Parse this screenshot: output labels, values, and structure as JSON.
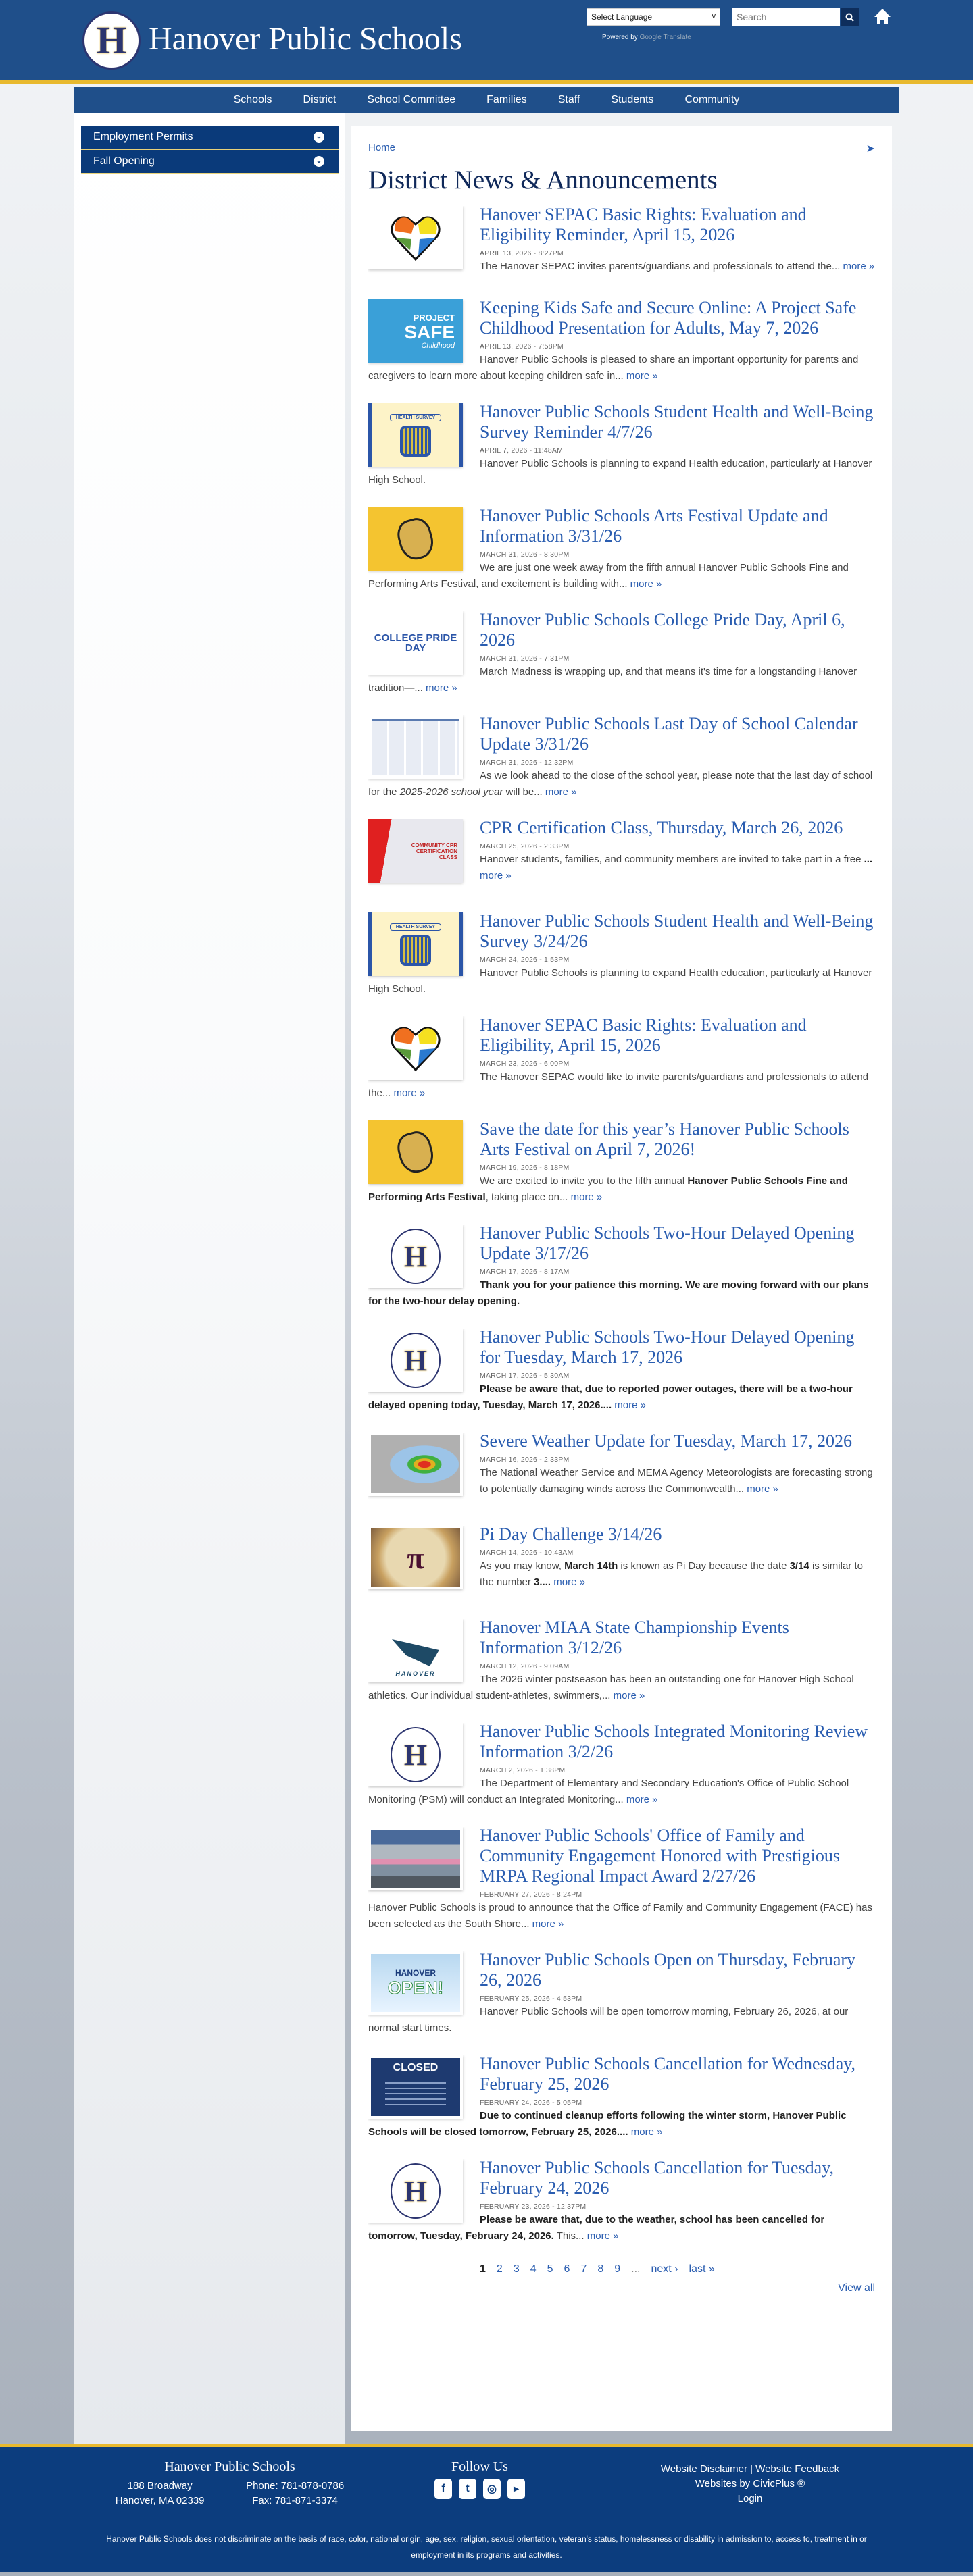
{
  "header": {
    "logo_letter": "H",
    "title": "Hanover Public Schools",
    "language_select": "Select Language",
    "powered_by": "Powered by",
    "translate": "Google Translate",
    "search_placeholder": "Search"
  },
  "nav": [
    "Schools",
    "District",
    "School Committee",
    "Families",
    "Staff",
    "Students",
    "Community"
  ],
  "sidebar": [
    "Employment Permits",
    "Fall Opening"
  ],
  "breadcrumb": "Home",
  "page_title": "District News & Announcements",
  "more_label": "more »",
  "items": [
    {
      "thumb": "sepac-heart",
      "title": "Hanover SEPAC Basic Rights: Evaluation and Eligibility Reminder, April 15, 2026",
      "date": "APRIL 13, 2026 - 8:27PM",
      "body": [
        {
          "t": "The Hanover SEPAC invites parents/guardians and professionals to attend the... "
        }
      ],
      "more": true
    },
    {
      "thumb": "project-safe",
      "title": "Keeping Kids Safe and Secure Online: A Project Safe Childhood Presentation for Adults, May 7, 2026",
      "date": "APRIL 13, 2026 - 7:58PM",
      "body": [
        {
          "t": "Hanover Public Schools is pleased to share an important opportunity for parents and caregivers to learn more about keeping children safe in... "
        }
      ],
      "more": true
    },
    {
      "thumb": "health-survey",
      "title": "Hanover Public Schools Student Health and Well-Being Survey Reminder 4/7/26",
      "date": "APRIL 7, 2026 - 11:48AM",
      "body": [
        {
          "t": "Hanover Public Schools is planning to expand Health education, particularly at Hanover High School."
        }
      ],
      "more": false
    },
    {
      "thumb": "arts-festival",
      "title": "Hanover Public Schools Arts Festival Update and Information 3/31/26",
      "date": "MARCH 31, 2026 - 8:30PM",
      "body": [
        {
          "t": "We are just one week away from the fifth annual Hanover Public Schools Fine and Performing Arts Festival, and excitement is building with... "
        }
      ],
      "more": true
    },
    {
      "thumb": "college-pride",
      "title": "Hanover Public Schools College Pride Day, April 6, 2026",
      "date": "MARCH 31, 2026 - 7:31PM",
      "body": [
        {
          "t": "March Madness is wrapping up, and that means it's time for a longstanding Hanover tradition—... "
        }
      ],
      "more": true
    },
    {
      "thumb": "calendar",
      "title": "Hanover Public Schools Last Day of School Calendar Update 3/31/26",
      "date": "MARCH 31, 2026 - 12:32PM",
      "body": [
        {
          "t": "As we look ahead to the close of the school year, please note that the last day of school for the "
        },
        {
          "t": "2025-2026 school year",
          "i": true
        },
        {
          "t": " will be... "
        }
      ],
      "more": true
    },
    {
      "thumb": "cpr",
      "title": "CPR Certification Class, Thursday, March 26, 2026",
      "date": "MARCH 25, 2026 - 2:33PM",
      "body": [
        {
          "t": "Hanover students, families, and community members are invited to take part in a free "
        },
        {
          "t": "...",
          "b": true
        },
        {
          "t": " "
        }
      ],
      "more": true
    },
    {
      "thumb": "health-survey",
      "title": "Hanover Public Schools Student Health and Well-Being Survey 3/24/26",
      "date": "MARCH 24, 2026 - 1:53PM",
      "body": [
        {
          "t": "Hanover Public Schools is planning to expand Health education, particularly at Hanover High School."
        }
      ],
      "more": false
    },
    {
      "thumb": "sepac-heart",
      "title": "Hanover SEPAC Basic Rights: Evaluation and Eligibility, April 15, 2026",
      "date": "MARCH 23, 2026 - 6:00PM",
      "body": [
        {
          "t": "The Hanover SEPAC would like to invite parents/guardians and professionals to attend the... "
        }
      ],
      "more": true
    },
    {
      "thumb": "arts-festival",
      "title": "Save the date for this year’s Hanover Public Schools Arts Festival on April 7, 2026!",
      "date": "MARCH 19, 2026 - 8:18PM",
      "body": [
        {
          "t": "We are excited to invite you to the fifth annual "
        },
        {
          "t": "Hanover Public Schools Fine and Performing Arts Festival",
          "b": true
        },
        {
          "t": ", taking place on... "
        }
      ],
      "more": true
    },
    {
      "thumb": "h-logo",
      "title": "Hanover Public Schools Two-Hour Delayed Opening Update 3/17/26",
      "date": "MARCH 17, 2026 - 8:17AM",
      "body": [
        {
          "t": "Thank you for your patience this morning. We are moving forward with our plans for the two-hour delay opening.",
          "b": true
        }
      ],
      "more": false
    },
    {
      "thumb": "h-logo",
      "title": "Hanover Public Schools Two-Hour Delayed Opening for Tuesday, March 17, 2026",
      "date": "MARCH 17, 2026 - 5:30AM",
      "body": [
        {
          "t": "Please be aware that, due to reported power outages, there will be a two-hour delayed opening today, Tuesday, March 17, 2026....",
          "b": true
        },
        {
          "t": " "
        }
      ],
      "more": true
    },
    {
      "thumb": "weather-map",
      "title": "Severe Weather Update for Tuesday, March 17, 2026",
      "date": "MARCH 16, 2026 - 2:33PM",
      "body": [
        {
          "t": "The National Weather Service and MEMA Agency Meteorologists are forecasting strong to potentially damaging winds across the Commonwealth... "
        }
      ],
      "more": true
    },
    {
      "thumb": "pi-pie",
      "title": "Pi Day Challenge 3/14/26",
      "date": "MARCH 14, 2026 - 10:43AM",
      "body": [
        {
          "t": "As you may know, "
        },
        {
          "t": "March 14th",
          "b": true
        },
        {
          "t": " is known as Pi Day because the date "
        },
        {
          "t": "3/14",
          "b": true
        },
        {
          "t": " is similar to the number "
        },
        {
          "t": "3....",
          "b": true
        },
        {
          "t": " "
        }
      ],
      "more": true
    },
    {
      "thumb": "hawk",
      "title": "Hanover MIAA State Championship Events Information 3/12/26",
      "date": "MARCH 12, 2026 - 9:09AM",
      "body": [
        {
          "t": "The 2026 winter postseason has been an outstanding one for Hanover High School athletics. Our individual student-athletes, swimmers,... "
        }
      ],
      "more": true
    },
    {
      "thumb": "h-logo",
      "title": "Hanover Public Schools Integrated Monitoring Review Information 3/2/26",
      "date": "MARCH 2, 2026 - 1:38PM",
      "body": [
        {
          "t": "The Department of Elementary and Secondary Education's Office of Public School Monitoring (PSM) will conduct an Integrated Monitoring... "
        }
      ],
      "more": true
    },
    {
      "thumb": "group-photo",
      "title": "Hanover Public Schools' Office of Family and Community Engagement Honored with Prestigious MRPA Regional Impact Award 2/27/26",
      "date": "FEBRUARY 27, 2026 - 8:24PM",
      "body": [
        {
          "t": "Hanover Public Schools is proud to announce that the Office of Family and Community Engagement (FACE) has been selected as the South Shore... "
        }
      ],
      "more": true
    },
    {
      "thumb": "open",
      "title": "Hanover Public Schools Open on Thursday, February 26, 2026",
      "date": "FEBRUARY 25, 2026 - 4:53PM",
      "body": [
        {
          "t": "Hanover Public Schools will be open tomorrow morning, February 26, 2026, at our normal start times."
        }
      ],
      "more": false
    },
    {
      "thumb": "closed",
      "title": "Hanover Public Schools Cancellation for Wednesday, February 25, 2026",
      "date": "FEBRUARY 24, 2026 - 5:05PM",
      "body": [
        {
          "t": "Due to continued cleanup efforts following the winter storm, Hanover Public Schools will be closed tomorrow, February 25, 2026....",
          "b": true
        },
        {
          "t": " "
        }
      ],
      "more": true
    },
    {
      "thumb": "h-logo",
      "title": "Hanover Public Schools Cancellation for Tuesday, February 24, 2026",
      "date": "FEBRUARY 23, 2026 - 12:37PM",
      "body": [
        {
          "t": "Please be aware that, due to the weather, school has been cancelled for tomorrow, Tuesday, February 24, 2026.",
          "b": true
        },
        {
          "t": " This... "
        }
      ],
      "more": true
    }
  ],
  "thumb_text": {
    "project": "PROJECT",
    "safe": "SAFE",
    "childhood": "Childhood",
    "health": "HEALTH SURVEY",
    "college": "COLLEGE PRIDE DAY",
    "cpr": "COMMUNITY CPR CERTIFICATION CLASS",
    "hanover": "HANOVER",
    "open": "OPEN!",
    "closed": "CLOSED",
    "pi": "π"
  },
  "pager": {
    "current": "1",
    "pages": [
      "2",
      "3",
      "4",
      "5",
      "6",
      "7",
      "8",
      "9"
    ],
    "ellipsis": "...",
    "next": "next ›",
    "last": "last »",
    "view_all": "View all"
  },
  "footer": {
    "org": "Hanover Public Schools",
    "address1": "188 Broadway",
    "address2": "Hanover, MA 02339",
    "phone": "Phone: 781-878-0786",
    "fax": "Fax: 781-871-3374",
    "follow": "Follow Us",
    "social": [
      "f",
      "t",
      "ig",
      "yt"
    ],
    "links": "Website Disclaimer | Website Feedback",
    "civicplus": "Websites by CivicPlus ®",
    "login": "Login",
    "nondiscrimination": "Hanover Public Schools does not discriminate on the basis of race, color, national origin, age, sex, religion, sexual orientation, veteran's status, homelessness or disability in admission to, access to, treatment in or employment in its programs and activities."
  },
  "colors": {
    "brand": "#1f4f8a",
    "gold": "#e8b92e",
    "link": "#2a5db0",
    "footer": "#0c3d7e"
  }
}
